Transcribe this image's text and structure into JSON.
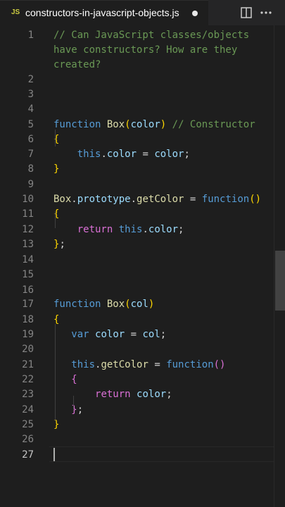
{
  "tab": {
    "icon_label": "JS",
    "file_name": "constructors-in-javascript-objects.js",
    "modified": true
  },
  "toolbar": {
    "split_icon": "split-editor-icon",
    "more_icon": "more-actions-icon"
  },
  "colors": {
    "comment": "#6a9955",
    "keyword": "#569cd6",
    "function": "#dcdcaa",
    "variable": "#9cdcfe",
    "text": "#d4d4d4",
    "bracket1": "#ffd700",
    "bracket2": "#da70d6",
    "bracket3": "#179fff"
  },
  "editor": {
    "current_line": 27,
    "line_numbers": [
      "1",
      "2",
      "3",
      "4",
      "5",
      "6",
      "7",
      "8",
      "9",
      "10",
      "11",
      "12",
      "13",
      "14",
      "15",
      "16",
      "17",
      "18",
      "19",
      "20",
      "21",
      "22",
      "23",
      "24",
      "25",
      "26",
      "27"
    ],
    "lines": [
      [
        {
          "t": "// Can JavaScript classes/objects",
          "c": "comment"
        }
      ],
      [
        {
          "t": "have constructors? How are they",
          "c": "comment"
        }
      ],
      [
        {
          "t": "created?",
          "c": "comment"
        }
      ],
      [],
      [],
      [],
      [
        {
          "t": "function",
          "c": "keyword"
        },
        {
          "t": " ",
          "c": "text"
        },
        {
          "t": "Box",
          "c": "function"
        },
        {
          "t": "(",
          "c": "bracket1"
        },
        {
          "t": "color",
          "c": "variable"
        },
        {
          "t": ")",
          "c": "bracket1"
        },
        {
          "t": " ",
          "c": "text"
        },
        {
          "t": "// Constructor",
          "c": "comment"
        }
      ],
      [
        {
          "t": "{",
          "c": "bracket1"
        }
      ],
      [
        {
          "t": "    ",
          "c": "text"
        },
        {
          "t": "this",
          "c": "keyword"
        },
        {
          "t": ".",
          "c": "text"
        },
        {
          "t": "color",
          "c": "variable"
        },
        {
          "t": " = ",
          "c": "text"
        },
        {
          "t": "color",
          "c": "variable"
        },
        {
          "t": ";",
          "c": "text"
        }
      ],
      [
        {
          "t": "}",
          "c": "bracket1"
        }
      ],
      [],
      [
        {
          "t": "Box",
          "c": "function"
        },
        {
          "t": ".",
          "c": "text"
        },
        {
          "t": "prototype",
          "c": "variable"
        },
        {
          "t": ".",
          "c": "text"
        },
        {
          "t": "getColor",
          "c": "function"
        },
        {
          "t": " = ",
          "c": "text"
        },
        {
          "t": "function",
          "c": "keyword"
        },
        {
          "t": "()",
          "c": "bracket1"
        }
      ],
      [
        {
          "t": "{",
          "c": "bracket1"
        }
      ],
      [
        {
          "t": "    ",
          "c": "text"
        },
        {
          "t": "return",
          "c": "bracket2"
        },
        {
          "t": " ",
          "c": "text"
        },
        {
          "t": "this",
          "c": "keyword"
        },
        {
          "t": ".",
          "c": "text"
        },
        {
          "t": "color",
          "c": "variable"
        },
        {
          "t": ";",
          "c": "text"
        }
      ],
      [
        {
          "t": "}",
          "c": "bracket1"
        },
        {
          "t": ";",
          "c": "text"
        }
      ],
      [],
      [],
      [],
      [
        {
          "t": "function",
          "c": "keyword"
        },
        {
          "t": " ",
          "c": "text"
        },
        {
          "t": "Box",
          "c": "function"
        },
        {
          "t": "(",
          "c": "bracket1"
        },
        {
          "t": "col",
          "c": "variable"
        },
        {
          "t": ")",
          "c": "bracket1"
        }
      ],
      [
        {
          "t": "{",
          "c": "bracket1"
        }
      ],
      [
        {
          "t": "   ",
          "c": "text"
        },
        {
          "t": "var",
          "c": "keyword"
        },
        {
          "t": " ",
          "c": "text"
        },
        {
          "t": "color",
          "c": "variable"
        },
        {
          "t": " = ",
          "c": "text"
        },
        {
          "t": "col",
          "c": "variable"
        },
        {
          "t": ";",
          "c": "text"
        }
      ],
      [],
      [
        {
          "t": "   ",
          "c": "text"
        },
        {
          "t": "this",
          "c": "keyword"
        },
        {
          "t": ".",
          "c": "text"
        },
        {
          "t": "getColor",
          "c": "function"
        },
        {
          "t": " = ",
          "c": "text"
        },
        {
          "t": "function",
          "c": "keyword"
        },
        {
          "t": "()",
          "c": "bracket2"
        }
      ],
      [
        {
          "t": "   ",
          "c": "text"
        },
        {
          "t": "{",
          "c": "bracket2"
        }
      ],
      [
        {
          "t": "       ",
          "c": "text"
        },
        {
          "t": "return",
          "c": "bracket2"
        },
        {
          "t": " ",
          "c": "text"
        },
        {
          "t": "color",
          "c": "variable"
        },
        {
          "t": ";",
          "c": "text"
        }
      ],
      [
        {
          "t": "   ",
          "c": "text"
        },
        {
          "t": "}",
          "c": "bracket2"
        },
        {
          "t": ";",
          "c": "text"
        }
      ],
      [
        {
          "t": "}",
          "c": "bracket1"
        }
      ],
      [],
      []
    ]
  }
}
